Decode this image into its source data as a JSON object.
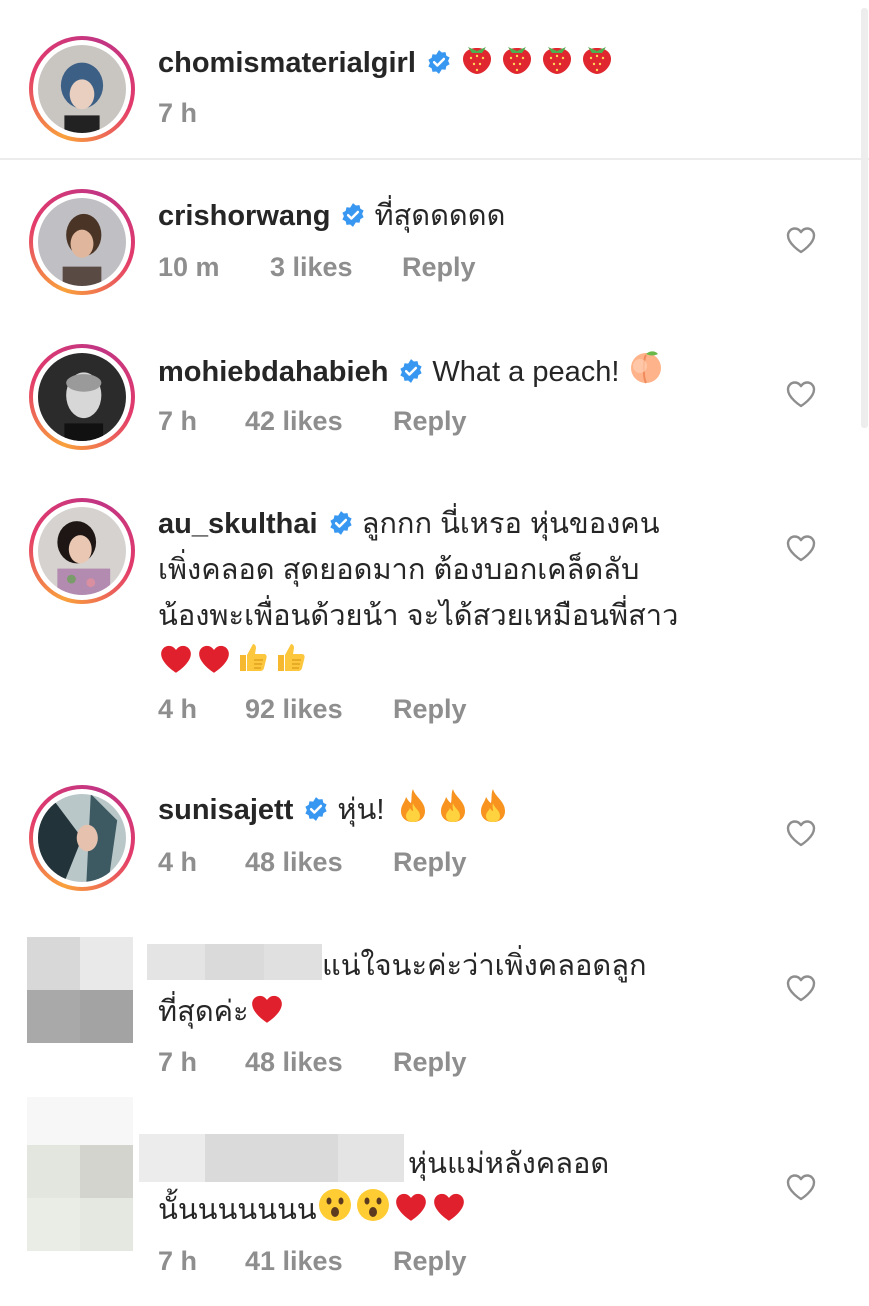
{
  "comments": [
    {
      "username": "chomismaterialgirl",
      "text": "",
      "time": "7 h",
      "likes": "",
      "reply": "",
      "emojis": [
        "strawberry-icon",
        "strawberry-icon",
        "strawberry-icon",
        "strawberry-icon"
      ]
    },
    {
      "username": "crishorwang",
      "text": "ที่สุดดดดด",
      "time": "10 m",
      "likes": "3 likes",
      "reply": "Reply"
    },
    {
      "username": "mohiebdahabieh",
      "text": "What a peach!",
      "time": "7 h",
      "likes": "42 likes",
      "reply": "Reply",
      "emojis": [
        "peach-icon"
      ]
    },
    {
      "username": "au_skulthai",
      "text_lines": [
        "ลูกกก นี่เหรอ หุ่นของคน",
        "เพิ่งคลอด สุดยอดมาก ต้องบอกเคล็ดลับ",
        "น้องพะเพื่อนด้วยน้า จะได้สวยเหมือนพี่สาว"
      ],
      "time": "4 h",
      "likes": "92 likes",
      "reply": "Reply",
      "emojis": [
        "red-heart-icon",
        "red-heart-icon",
        "thumbs-up-icon",
        "thumbs-up-icon"
      ]
    },
    {
      "username": "sunisajett",
      "text": "หุ่น!",
      "time": "4 h",
      "likes": "48 likes",
      "reply": "Reply",
      "emojis": [
        "fire-icon",
        "fire-icon",
        "fire-icon"
      ]
    },
    {
      "username": "",
      "text_line1": "แน่ใจนะค่ะว่าเพิ่งคลอดลูก",
      "text_line2": "ที่สุดค่ะ",
      "time": "7 h",
      "likes": "48 likes",
      "reply": "Reply",
      "emojis": [
        "red-heart-icon"
      ]
    },
    {
      "username": "",
      "text_line1": "หุ่นแม่หลังคลอด",
      "text_line2": "นั้นนนนนนน",
      "time": "7 h",
      "likes": "41 likes",
      "reply": "Reply",
      "emojis": [
        "astonished-face-icon",
        "astonished-face-icon",
        "red-heart-icon",
        "red-heart-icon"
      ]
    }
  ],
  "colors": {
    "verified": "#3897f0",
    "meta_text": "#8e8e8e",
    "username": "#262626",
    "heart_outline": "#8e8e8e"
  }
}
